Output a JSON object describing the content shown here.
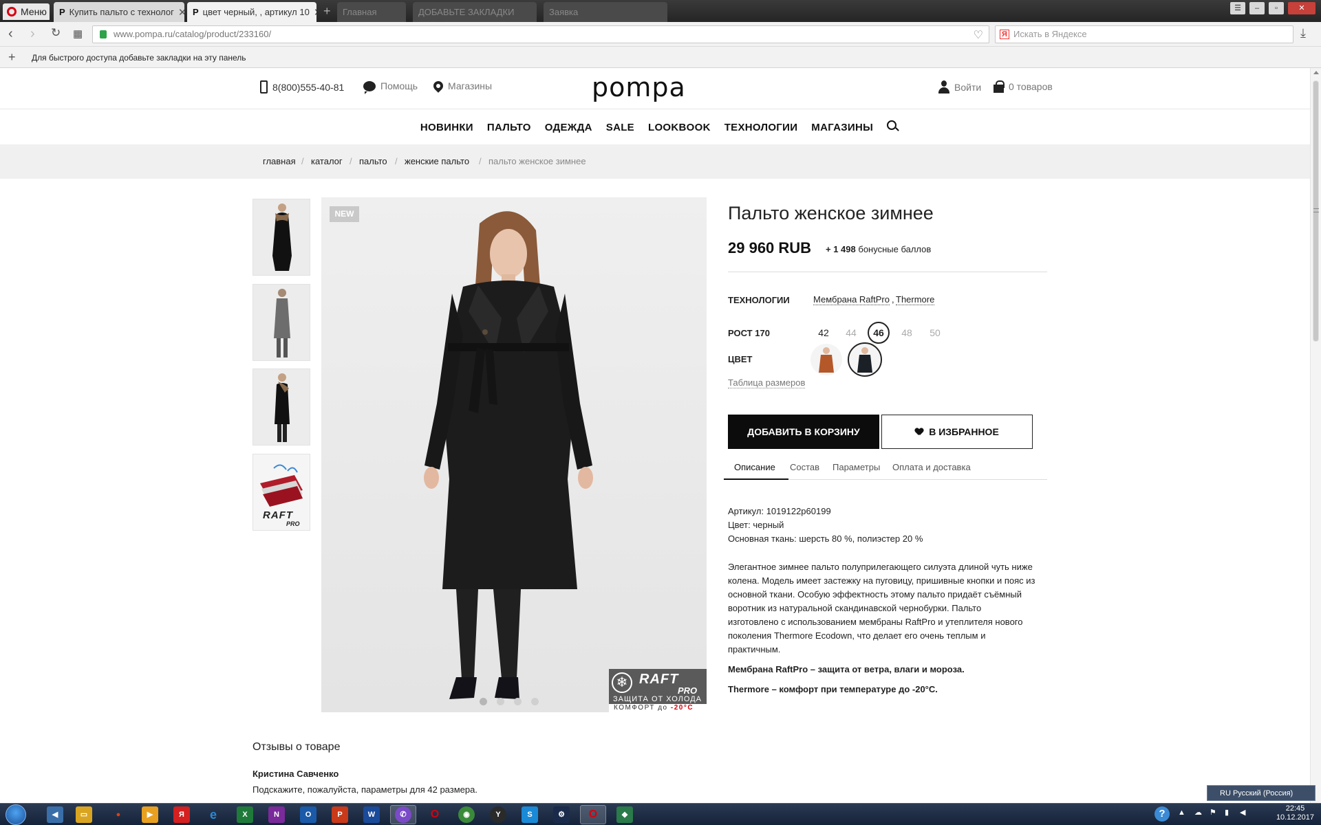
{
  "browser": {
    "menu_label": "Меню",
    "tabs": [
      {
        "label": "Купить пальто с технолог",
        "favicon": "P"
      },
      {
        "label": "цвет черный, , артикул 10",
        "favicon": "P"
      },
      {
        "label": "Главная",
        "favicon": ""
      },
      {
        "label": "ДОБАВЬТЕ ЗАКЛАДКИ",
        "favicon": ""
      },
      {
        "label": "Заявка",
        "favicon": ""
      }
    ],
    "url": "www.pompa.ru/catalog/product/233160/",
    "search_placeholder": "Искать в Яндексе",
    "bookmarks_hint": "Для быстрого доступа добавьте закладки на эту панель"
  },
  "site": {
    "phone": "8(800)555-40-81",
    "help": "Помощь",
    "stores": "Магазины",
    "logo": "pompa",
    "login": "Войти",
    "cart": "0 товаров",
    "nav": [
      "НОВИНКИ",
      "ПАЛЬТО",
      "ОДЕЖДА",
      "SALE",
      "LOOKBOOK",
      "ТЕХНОЛОГИИ",
      "МАГАЗИНЫ"
    ],
    "breadcrumbs": [
      "главная",
      "каталог",
      "пальто",
      "женские пальто",
      "пальто женское зимнее"
    ]
  },
  "gallery": {
    "badge": "NEW",
    "raft_title": "RAFT",
    "raft_pro": "PRO",
    "raft_caption": "ЗАЩИТА ОТ ХОЛОДА",
    "raft_comfort": "КОМФОРТ до",
    "raft_temp": "-20°C",
    "thumb_logo": "RAFT",
    "thumb_logo_pro": "PRO"
  },
  "product": {
    "title": "Пальто женское зимнее",
    "price": "29 960 RUB",
    "bonus_value": "+ 1 498",
    "bonus_text": "бонусные баллов",
    "tech_label": "ТЕХНОЛОГИИ",
    "tech_links": [
      "Мембрана RaftPro",
      "Thermore"
    ],
    "tech_sep": ",",
    "height_label": "РОСТ 170",
    "sizes": [
      {
        "value": "42",
        "available": true,
        "selected": false
      },
      {
        "value": "44",
        "available": false,
        "selected": false
      },
      {
        "value": "46",
        "available": true,
        "selected": true
      },
      {
        "value": "48",
        "available": false,
        "selected": false
      },
      {
        "value": "50",
        "available": false,
        "selected": false
      }
    ],
    "color_label": "ЦВЕТ",
    "colors": [
      {
        "name": "brown",
        "hex": "#b4582a",
        "selected": false
      },
      {
        "name": "black",
        "hex": "#1b1f26",
        "selected": true
      }
    ],
    "size_table": "Таблица размеров",
    "add_to_cart": "ДОБАВИТЬ В КОРЗИНУ",
    "add_to_fav": "В ИЗБРАННОЕ",
    "tabs": [
      "Описание",
      "Состав",
      "Параметры",
      "Оплата и доставка"
    ],
    "article": "Артикул: 1019122р60199",
    "color": "Цвет: черный",
    "fabric": "Основная ткань: шерсть 80 %, полиэстер 20 %",
    "description_lines": [
      "Элегантное зимнее пальто полуприлегающего силуэта длиной чуть ниже",
      "колена. Модель имеет застежку на пуговицу, пришивные кнопки и пояс из",
      "основной ткани. Особую эффектность этому пальто придаёт съёмный",
      "воротник из натуральной скандинавской чернобурки. Пальто",
      "изготовлено с использованием мембраны RaftPro и утеплителя нового",
      "поколения Thermore Ecodown, что делает его очень теплым и",
      "практичным."
    ],
    "feature1": "Мембрана RaftPro – защита от ветра, влаги и мороза.",
    "feature2": "Thermore – комфорт при температуре до -20°С."
  },
  "reviews": {
    "heading": "Отзывы о товаре",
    "author": "Кристина Савченко",
    "text": "Подскажите, пожалуйста, параметры для 42 размера."
  },
  "taskbar": {
    "lang": "RU Русский (Россия)",
    "time": "22:45",
    "date": "10.12.2017"
  }
}
